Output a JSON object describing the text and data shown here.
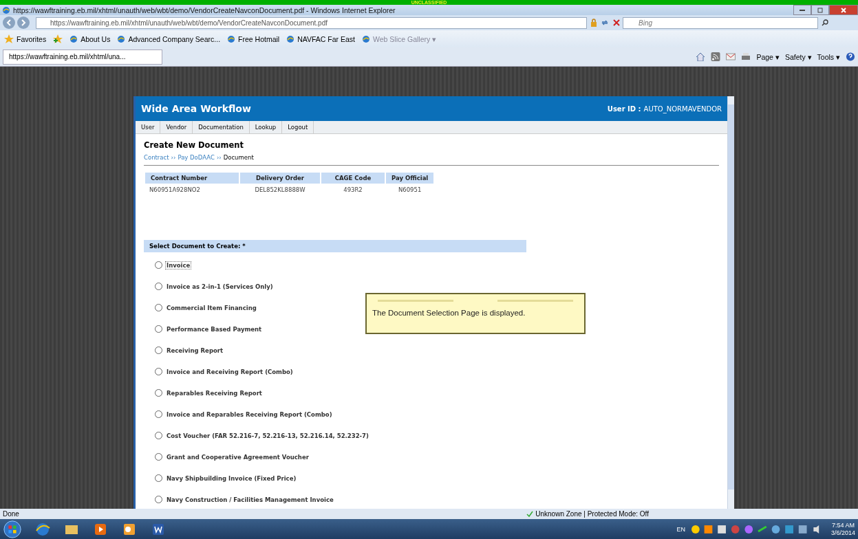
{
  "classification_banner": "UNCLASSIFIED",
  "window": {
    "title": "https://wawftraining.eb.mil/xhtml/unauth/web/wbt/demo/VendorCreateNavconDocument.pdf - Windows Internet Explorer"
  },
  "address_bar": {
    "value": "https://wawftraining.eb.mil/xhtml/unauth/web/wbt/demo/VendorCreateNavconDocument.pdf"
  },
  "search": {
    "placeholder": "Bing"
  },
  "favorites_bar": {
    "label": "Favorites",
    "items": [
      {
        "label": "About Us",
        "disabled": false
      },
      {
        "label": "Advanced Company Searc...",
        "disabled": false
      },
      {
        "label": "Free Hotmail",
        "disabled": false
      },
      {
        "label": "NAVFAC Far East",
        "disabled": false
      },
      {
        "label": "Web Slice Gallery ▾",
        "disabled": true
      }
    ]
  },
  "tabs": [
    {
      "label": "https://wawftraining.eb.mil/xhtml/una...",
      "selected": true
    }
  ],
  "command_bar": [
    "Page ▾",
    "Safety ▾",
    "Tools ▾"
  ],
  "page": {
    "app_title": "Wide Area Workflow",
    "user_id_label": "User ID :",
    "user_id": "AUTO_NORMAVENDOR",
    "menu": [
      "User",
      "Vendor",
      "Documentation",
      "Lookup",
      "Logout"
    ],
    "heading": "Create New Document",
    "breadcrumb": [
      {
        "label": "Contract",
        "link": true
      },
      {
        "label": "Pay DoDAAC",
        "link": true
      },
      {
        "label": "Document",
        "link": false
      }
    ],
    "breadcrumb_separator": "››",
    "table": {
      "columns": [
        "Contract Number",
        "Delivery Order",
        "CAGE Code",
        "Pay Official"
      ],
      "rows": [
        [
          "N60951A928NO2",
          "DEL852KL8888W",
          "493R2",
          "N60951"
        ]
      ]
    },
    "select_label": "Select Document to Create: *",
    "options": [
      {
        "label": "Invoice",
        "selected": false,
        "focused": true
      },
      {
        "label": "Invoice as 2-in-1 (Services Only)",
        "selected": false,
        "focused": false
      },
      {
        "label": "Commercial Item Financing",
        "selected": false,
        "focused": false
      },
      {
        "label": "Performance Based Payment",
        "selected": false,
        "focused": false
      },
      {
        "label": "Receiving Report",
        "selected": false,
        "focused": false
      },
      {
        "label": "Invoice and Receiving Report (Combo)",
        "selected": false,
        "focused": false
      },
      {
        "label": "Reparables Receiving Report",
        "selected": false,
        "focused": false
      },
      {
        "label": "Invoice and Reparables Receiving Report (Combo)",
        "selected": false,
        "focused": false
      },
      {
        "label": "Cost Voucher (FAR 52.216-7, 52.216-13, 52.216.14, 52.232-7)",
        "selected": false,
        "focused": false
      },
      {
        "label": "Grant and Cooperative Agreement Voucher",
        "selected": false,
        "focused": false
      },
      {
        "label": "Navy Shipbuilding Invoice (Fixed Price)",
        "selected": false,
        "focused": false
      },
      {
        "label": "Navy Construction / Facilities Management Invoice",
        "selected": false,
        "focused": false
      }
    ],
    "callout": "The Document Selection Page is displayed."
  },
  "status_bar": {
    "text": "Done",
    "zone": "Unknown Zone | Protected Mode: Off"
  },
  "taskbar": {
    "language": "EN",
    "time": "7:54 AM",
    "date": "3/6/2014"
  }
}
